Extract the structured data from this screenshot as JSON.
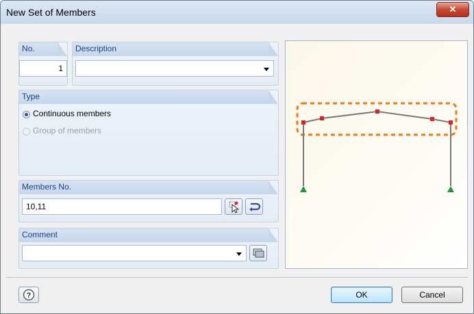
{
  "dialog": {
    "title": "New Set of Members",
    "close_glyph": "✕"
  },
  "no_group": {
    "label": "No.",
    "value": "1"
  },
  "description_group": {
    "label": "Description",
    "value": ""
  },
  "type_group": {
    "label": "Type",
    "options": [
      {
        "label": "Continuous members",
        "selected": true,
        "enabled": true
      },
      {
        "label": "Group of members",
        "selected": false,
        "enabled": false
      }
    ]
  },
  "members_group": {
    "label": "Members No.",
    "value": "10,11"
  },
  "comment_group": {
    "label": "Comment",
    "value": ""
  },
  "buttons": {
    "ok": "OK",
    "cancel": "Cancel",
    "help_glyph": "?"
  },
  "icons": {
    "pick": "pick-members-icon",
    "reverse": "reverse-icon",
    "comment": "comment-library-icon",
    "help": "help-icon"
  },
  "colors": {
    "accent": "#15428b",
    "node": "#e02020",
    "support": "#1a9a3a",
    "highlight": "#f07a10"
  }
}
